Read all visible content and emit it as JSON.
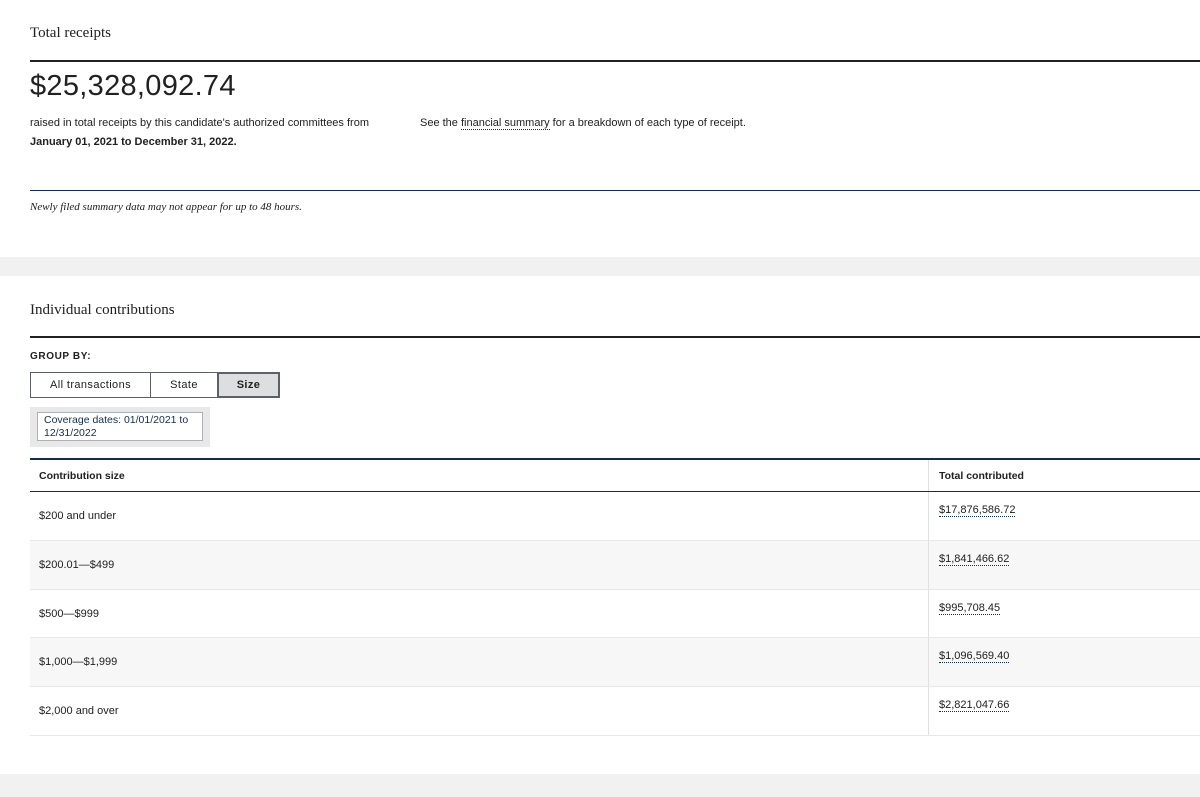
{
  "total_receipts": {
    "heading": "Total receipts",
    "amount": "$25,328,092.74",
    "raised_text": "raised in total receipts by this candidate's authorized committees from",
    "date_range": "January 01, 2021 to December 31, 2022.",
    "see_prefix": "See the ",
    "see_link": "financial summary",
    "see_suffix": " for a breakdown of each type of receipt.",
    "note": "Newly filed summary data may not appear for up to 48 hours."
  },
  "individual_contributions": {
    "heading": "Individual contributions",
    "group_by_label": "GROUP BY:",
    "tabs": [
      {
        "label": "All transactions",
        "active": false
      },
      {
        "label": "State",
        "active": false
      },
      {
        "label": "Size",
        "active": true
      }
    ],
    "coverage": "Coverage dates: 01/01/2021 to 12/31/2022",
    "table": {
      "headers": [
        "Contribution size",
        "Total contributed"
      ],
      "rows": [
        {
          "size": "$200 and under",
          "total": "$17,876,586.72"
        },
        {
          "size": "$200.01—$499",
          "total": "$1,841,466.62"
        },
        {
          "size": "$500—$999",
          "total": "$995,708.45"
        },
        {
          "size": "$1,000—$1,999",
          "total": "$1,096,569.40"
        },
        {
          "size": "$2,000 and over",
          "total": "$2,821,047.66"
        }
      ]
    }
  }
}
